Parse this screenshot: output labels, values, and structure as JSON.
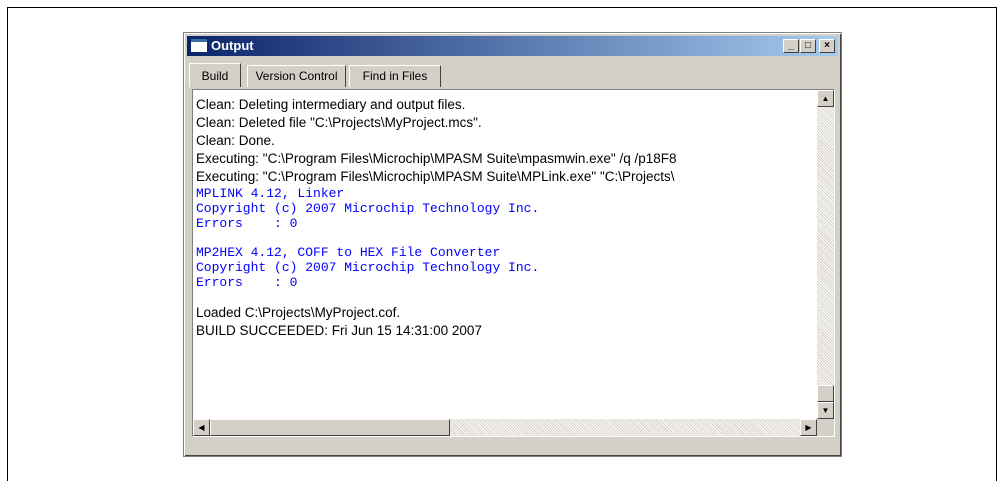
{
  "window": {
    "title": "Output",
    "controls": {
      "minimize": "_",
      "maximize": "□",
      "close": "×"
    }
  },
  "tabs": [
    {
      "label": "Build",
      "active": true
    },
    {
      "label": "Version Control",
      "active": false
    },
    {
      "label": "Find in Files",
      "active": false
    }
  ],
  "output": {
    "lines": [
      {
        "text": "Clean: Deleting intermediary and output files.",
        "style": "normal"
      },
      {
        "text": "Clean: Deleted file \"C:\\Projects\\MyProject.mcs\".",
        "style": "normal"
      },
      {
        "text": "Clean: Done.",
        "style": "normal"
      },
      {
        "text": "Executing: \"C:\\Program Files\\Microchip\\MPASM Suite\\mpasmwin.exe\" /q /p18F8",
        "style": "normal"
      },
      {
        "text": "Executing: \"C:\\Program Files\\Microchip\\MPASM Suite\\MPLink.exe\" \"C:\\Projects\\",
        "style": "normal"
      },
      {
        "text": "MPLINK 4.12, Linker",
        "style": "mono"
      },
      {
        "text": "Copyright (c) 2007 Microchip Technology Inc.",
        "style": "mono"
      },
      {
        "text": "Errors    : 0",
        "style": "mono"
      },
      {
        "text": "",
        "style": "blank"
      },
      {
        "text": "MP2HEX 4.12, COFF to HEX File Converter",
        "style": "mono"
      },
      {
        "text": "Copyright (c) 2007 Microchip Technology Inc.",
        "style": "mono"
      },
      {
        "text": "Errors    : 0",
        "style": "mono"
      },
      {
        "text": "",
        "style": "blank"
      },
      {
        "text": "Loaded C:\\Projects\\MyProject.cof.",
        "style": "normal"
      },
      {
        "text": "BUILD SUCCEEDED: Fri Jun 15 14:31:00 2007",
        "style": "normal"
      }
    ]
  },
  "colors": {
    "titlebar_start": "#0a246a",
    "titlebar_end": "#a6caf0",
    "mono_text": "#0000ff",
    "chrome": "#d4d0c8"
  },
  "scrollbars": {
    "vertical": {
      "up_arrow": "▲",
      "down_arrow": "▼"
    },
    "horizontal": {
      "left_arrow": "◀",
      "right_arrow": "▶"
    }
  }
}
